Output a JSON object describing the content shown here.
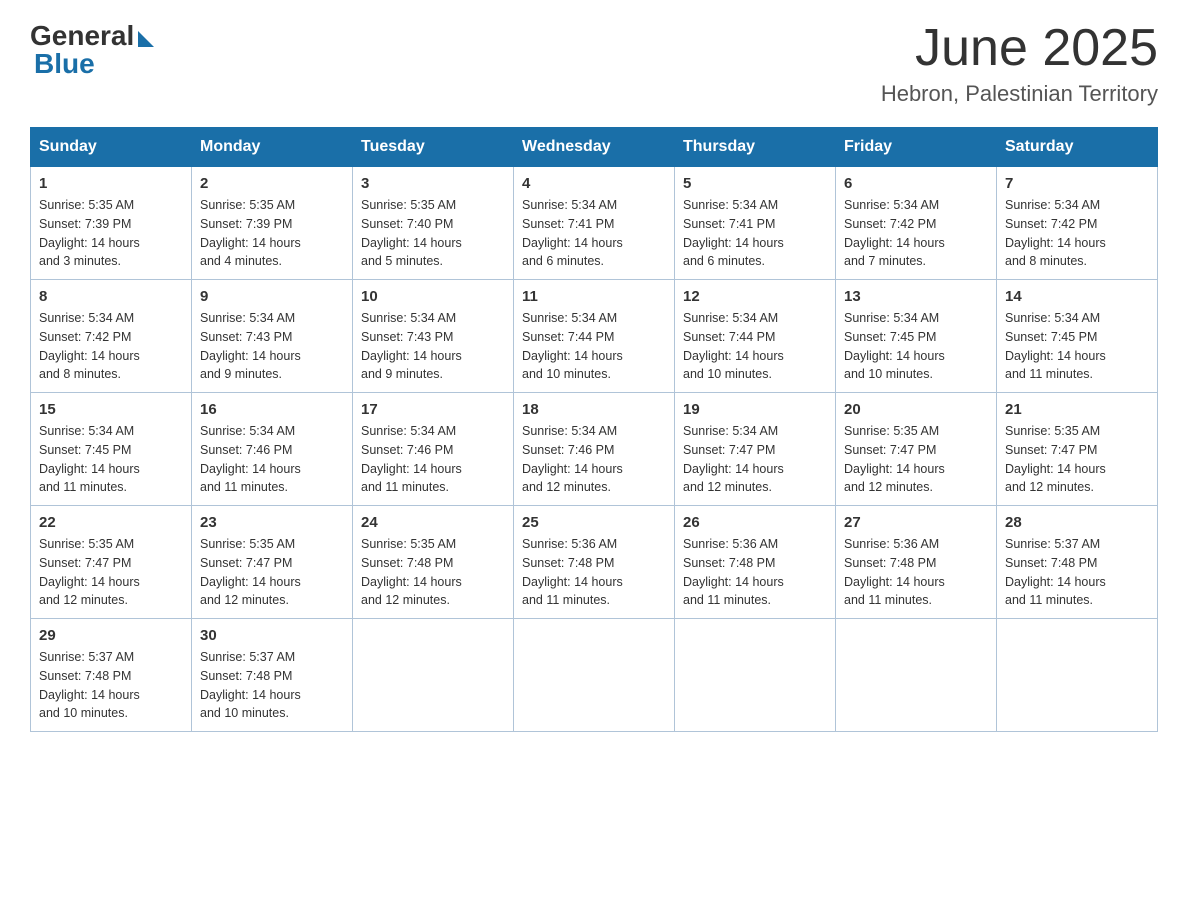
{
  "header": {
    "logo_general": "General",
    "logo_blue": "Blue",
    "month_title": "June 2025",
    "location": "Hebron, Palestinian Territory"
  },
  "weekdays": [
    "Sunday",
    "Monday",
    "Tuesday",
    "Wednesday",
    "Thursday",
    "Friday",
    "Saturday"
  ],
  "rows": [
    [
      {
        "day": "1",
        "sunrise": "5:35 AM",
        "sunset": "7:39 PM",
        "daylight": "14 hours and 3 minutes."
      },
      {
        "day": "2",
        "sunrise": "5:35 AM",
        "sunset": "7:39 PM",
        "daylight": "14 hours and 4 minutes."
      },
      {
        "day": "3",
        "sunrise": "5:35 AM",
        "sunset": "7:40 PM",
        "daylight": "14 hours and 5 minutes."
      },
      {
        "day": "4",
        "sunrise": "5:34 AM",
        "sunset": "7:41 PM",
        "daylight": "14 hours and 6 minutes."
      },
      {
        "day": "5",
        "sunrise": "5:34 AM",
        "sunset": "7:41 PM",
        "daylight": "14 hours and 6 minutes."
      },
      {
        "day": "6",
        "sunrise": "5:34 AM",
        "sunset": "7:42 PM",
        "daylight": "14 hours and 7 minutes."
      },
      {
        "day": "7",
        "sunrise": "5:34 AM",
        "sunset": "7:42 PM",
        "daylight": "14 hours and 8 minutes."
      }
    ],
    [
      {
        "day": "8",
        "sunrise": "5:34 AM",
        "sunset": "7:42 PM",
        "daylight": "14 hours and 8 minutes."
      },
      {
        "day": "9",
        "sunrise": "5:34 AM",
        "sunset": "7:43 PM",
        "daylight": "14 hours and 9 minutes."
      },
      {
        "day": "10",
        "sunrise": "5:34 AM",
        "sunset": "7:43 PM",
        "daylight": "14 hours and 9 minutes."
      },
      {
        "day": "11",
        "sunrise": "5:34 AM",
        "sunset": "7:44 PM",
        "daylight": "14 hours and 10 minutes."
      },
      {
        "day": "12",
        "sunrise": "5:34 AM",
        "sunset": "7:44 PM",
        "daylight": "14 hours and 10 minutes."
      },
      {
        "day": "13",
        "sunrise": "5:34 AM",
        "sunset": "7:45 PM",
        "daylight": "14 hours and 10 minutes."
      },
      {
        "day": "14",
        "sunrise": "5:34 AM",
        "sunset": "7:45 PM",
        "daylight": "14 hours and 11 minutes."
      }
    ],
    [
      {
        "day": "15",
        "sunrise": "5:34 AM",
        "sunset": "7:45 PM",
        "daylight": "14 hours and 11 minutes."
      },
      {
        "day": "16",
        "sunrise": "5:34 AM",
        "sunset": "7:46 PM",
        "daylight": "14 hours and 11 minutes."
      },
      {
        "day": "17",
        "sunrise": "5:34 AM",
        "sunset": "7:46 PM",
        "daylight": "14 hours and 11 minutes."
      },
      {
        "day": "18",
        "sunrise": "5:34 AM",
        "sunset": "7:46 PM",
        "daylight": "14 hours and 12 minutes."
      },
      {
        "day": "19",
        "sunrise": "5:34 AM",
        "sunset": "7:47 PM",
        "daylight": "14 hours and 12 minutes."
      },
      {
        "day": "20",
        "sunrise": "5:35 AM",
        "sunset": "7:47 PM",
        "daylight": "14 hours and 12 minutes."
      },
      {
        "day": "21",
        "sunrise": "5:35 AM",
        "sunset": "7:47 PM",
        "daylight": "14 hours and 12 minutes."
      }
    ],
    [
      {
        "day": "22",
        "sunrise": "5:35 AM",
        "sunset": "7:47 PM",
        "daylight": "14 hours and 12 minutes."
      },
      {
        "day": "23",
        "sunrise": "5:35 AM",
        "sunset": "7:47 PM",
        "daylight": "14 hours and 12 minutes."
      },
      {
        "day": "24",
        "sunrise": "5:35 AM",
        "sunset": "7:48 PM",
        "daylight": "14 hours and 12 minutes."
      },
      {
        "day": "25",
        "sunrise": "5:36 AM",
        "sunset": "7:48 PM",
        "daylight": "14 hours and 11 minutes."
      },
      {
        "day": "26",
        "sunrise": "5:36 AM",
        "sunset": "7:48 PM",
        "daylight": "14 hours and 11 minutes."
      },
      {
        "day": "27",
        "sunrise": "5:36 AM",
        "sunset": "7:48 PM",
        "daylight": "14 hours and 11 minutes."
      },
      {
        "day": "28",
        "sunrise": "5:37 AM",
        "sunset": "7:48 PM",
        "daylight": "14 hours and 11 minutes."
      }
    ],
    [
      {
        "day": "29",
        "sunrise": "5:37 AM",
        "sunset": "7:48 PM",
        "daylight": "14 hours and 10 minutes."
      },
      {
        "day": "30",
        "sunrise": "5:37 AM",
        "sunset": "7:48 PM",
        "daylight": "14 hours and 10 minutes."
      },
      null,
      null,
      null,
      null,
      null
    ]
  ],
  "labels": {
    "sunrise": "Sunrise:",
    "sunset": "Sunset:",
    "daylight": "Daylight:"
  }
}
